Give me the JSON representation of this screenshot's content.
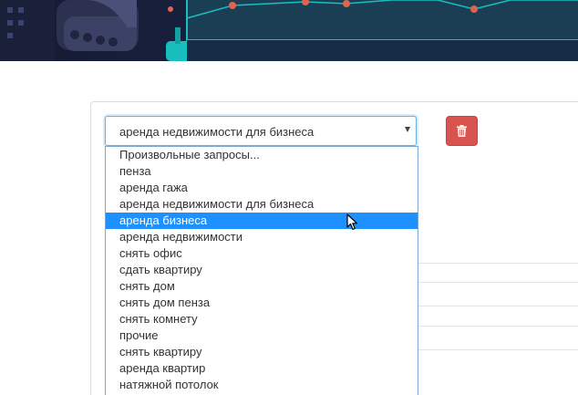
{
  "form": {
    "query_select": {
      "selected_value": "аренда недвижимости для бизнеса",
      "highlighted_option": "аренда бизнеса",
      "options": [
        "Произвольные запросы...",
        "пенза",
        "аренда гажа",
        "аренда недвижимости для бизнеса",
        "аренда бизнеса",
        "аренда недвижимости",
        "снять офис",
        "сдать квартиру",
        "снять дом",
        "снять дом пенза",
        "снять комнету",
        "прочие",
        "снять квартиру",
        "аренда квартир",
        "натяжной потолок"
      ]
    },
    "delete_button": {
      "icon": "trash-icon",
      "color": "#d9534f"
    }
  },
  "colors": {
    "highlight": "#1e90ff",
    "select_border": "#66afe9",
    "banner_bg": "#1c2340",
    "banner_teal": "#19bfbf",
    "banner_node": "#e0634f"
  }
}
